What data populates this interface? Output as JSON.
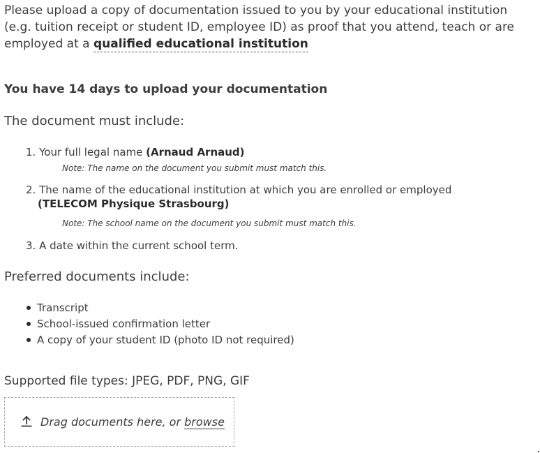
{
  "intro": {
    "text_before_link": "Please upload a copy of documentation issued to you by your educational institution (e.g. tuition receipt or student ID, employee ID) as proof that you attend, teach or are employed at a ",
    "link_label": "qualified educational institution"
  },
  "deadline": "You have 14 days to upload your documentation",
  "requirements": {
    "heading": "The document must include:",
    "items": [
      {
        "number": "1.",
        "text": "Your full legal name ",
        "value": "(Arnaud Arnaud)",
        "note": "Note: The name on the document you submit must match this."
      },
      {
        "number": "2.",
        "text": "The name of the educational institution at which you are enrolled or employed",
        "value": "(TELECOM Physique Strasbourg)",
        "note": "Note: The school name on the document you submit must match this."
      },
      {
        "number": "3.",
        "text": "A date within the current school term."
      }
    ]
  },
  "preferred": {
    "heading": "Preferred documents include:",
    "items": [
      "Transcript",
      "School-issued confirmation letter",
      "A copy of your student ID (photo ID not required)"
    ]
  },
  "file_types": "Supported file types: JPEG, PDF, PNG, GIF",
  "upload": {
    "icon": "upload-icon",
    "text": "Drag documents here, or ",
    "browse_label": "browse"
  }
}
